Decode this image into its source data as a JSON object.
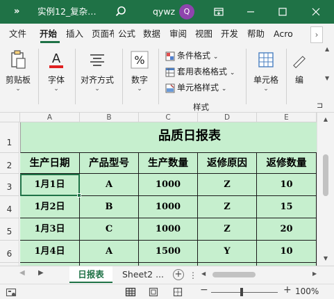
{
  "titlebar": {
    "quick_access": "»",
    "doc_title": "实例12_复杂…",
    "user": "qywz",
    "avatar_letter": "Q"
  },
  "tabs": [
    {
      "label": "文件"
    },
    {
      "label": "开始"
    },
    {
      "label": "插入"
    },
    {
      "label": "页面布局"
    },
    {
      "label": "公式"
    },
    {
      "label": "数据"
    },
    {
      "label": "审阅"
    },
    {
      "label": "视图"
    },
    {
      "label": "开发"
    },
    {
      "label": "帮助"
    },
    {
      "label": "Acro"
    }
  ],
  "active_tab": "开始",
  "ribbon": {
    "clipboard": "剪贴板",
    "font": "字体",
    "alignment": "对齐方式",
    "number": "数字",
    "conditional_format": "条件格式",
    "table_format": "套用表格格式",
    "cell_style": "单元格样式",
    "styles_group": "样式",
    "cells": "单元格",
    "editing": "编",
    "dropdown": "⌄"
  },
  "sheet": {
    "columns": [
      "A",
      "B",
      "C",
      "D",
      "E"
    ],
    "rows": [
      "1",
      "2",
      "3",
      "4",
      "5",
      "6"
    ],
    "title": "品质日报表",
    "headers": [
      "生产日期",
      "产品型号",
      "生产数量",
      "返修原因",
      "返修数量"
    ],
    "data": [
      [
        "1月1日",
        "A",
        "1000",
        "Z",
        "10"
      ],
      [
        "1月2日",
        "B",
        "1000",
        "Z",
        "15"
      ],
      [
        "1月3日",
        "C",
        "1000",
        "Z",
        "20"
      ],
      [
        "1月4日",
        "A",
        "1500",
        "Y",
        "10"
      ]
    ]
  },
  "sheet_tabs": {
    "active": "日报表",
    "other": "Sheet2 ..."
  },
  "status": {
    "zoom": "100%",
    "zoom_level": 1.0
  },
  "colors": {
    "excel_green": "#1f7246",
    "cell_fill": "#c6efce",
    "avatar": "#8e44ad"
  }
}
